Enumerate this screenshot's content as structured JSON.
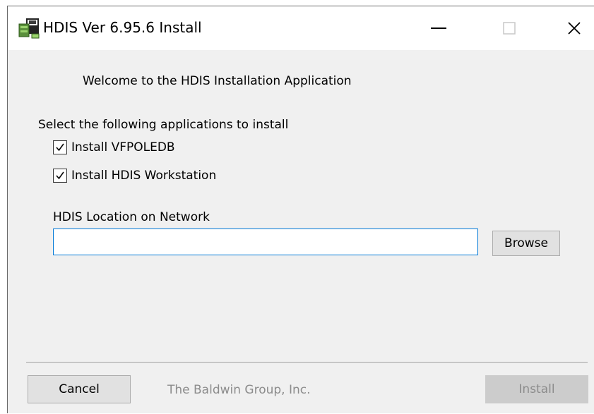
{
  "window": {
    "title": "HDIS Ver 6.95.6 Install",
    "minimize_icon": "minimize-icon",
    "maximize_icon": "maximize-icon",
    "close_icon": "close-icon"
  },
  "content": {
    "welcome_text": "Welcome to the HDIS Installation Application",
    "select_label": "Select the following applications to install",
    "options": [
      {
        "label": "Install VFPOLEDB",
        "checked": true
      },
      {
        "label": "Install HDIS Workstation",
        "checked": true
      }
    ],
    "network_label": "HDIS Location on Network",
    "network_value": "",
    "browse_label": "Browse"
  },
  "footer": {
    "cancel_label": "Cancel",
    "company": "The Baldwin Group, Inc.",
    "install_label": "Install",
    "install_enabled": false
  },
  "colors": {
    "window_bg": "#f0f0f0",
    "input_focus_border": "#0078d7",
    "disabled_text": "#8c8c8c"
  }
}
